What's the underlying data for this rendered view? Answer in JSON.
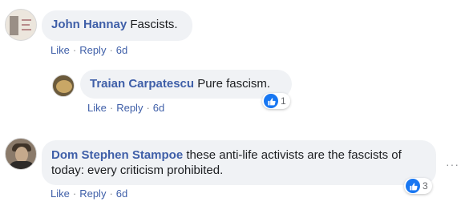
{
  "comments": [
    {
      "author": "John Hannay",
      "text": "Fascists.",
      "actions": {
        "like": "Like",
        "reply": "Reply",
        "time": "6d"
      }
    },
    {
      "author": "Traian Carpatescu",
      "text": "Pure fascism.",
      "actions": {
        "like": "Like",
        "reply": "Reply",
        "time": "6d"
      },
      "reaction_count": "1"
    },
    {
      "author": "Dom Stephen Stampoe",
      "text": "these anti-life activists are the fascists of today: every criticism prohibited.",
      "actions": {
        "like": "Like",
        "reply": "Reply",
        "time": "6d"
      },
      "reaction_count": "3"
    }
  ],
  "separator": "·",
  "more_options": "···",
  "colors": {
    "name": "#3f5fa8",
    "bubble": "#f0f2f5",
    "like": "#1877f2"
  },
  "icons": [
    "thumbs-up-icon"
  ]
}
